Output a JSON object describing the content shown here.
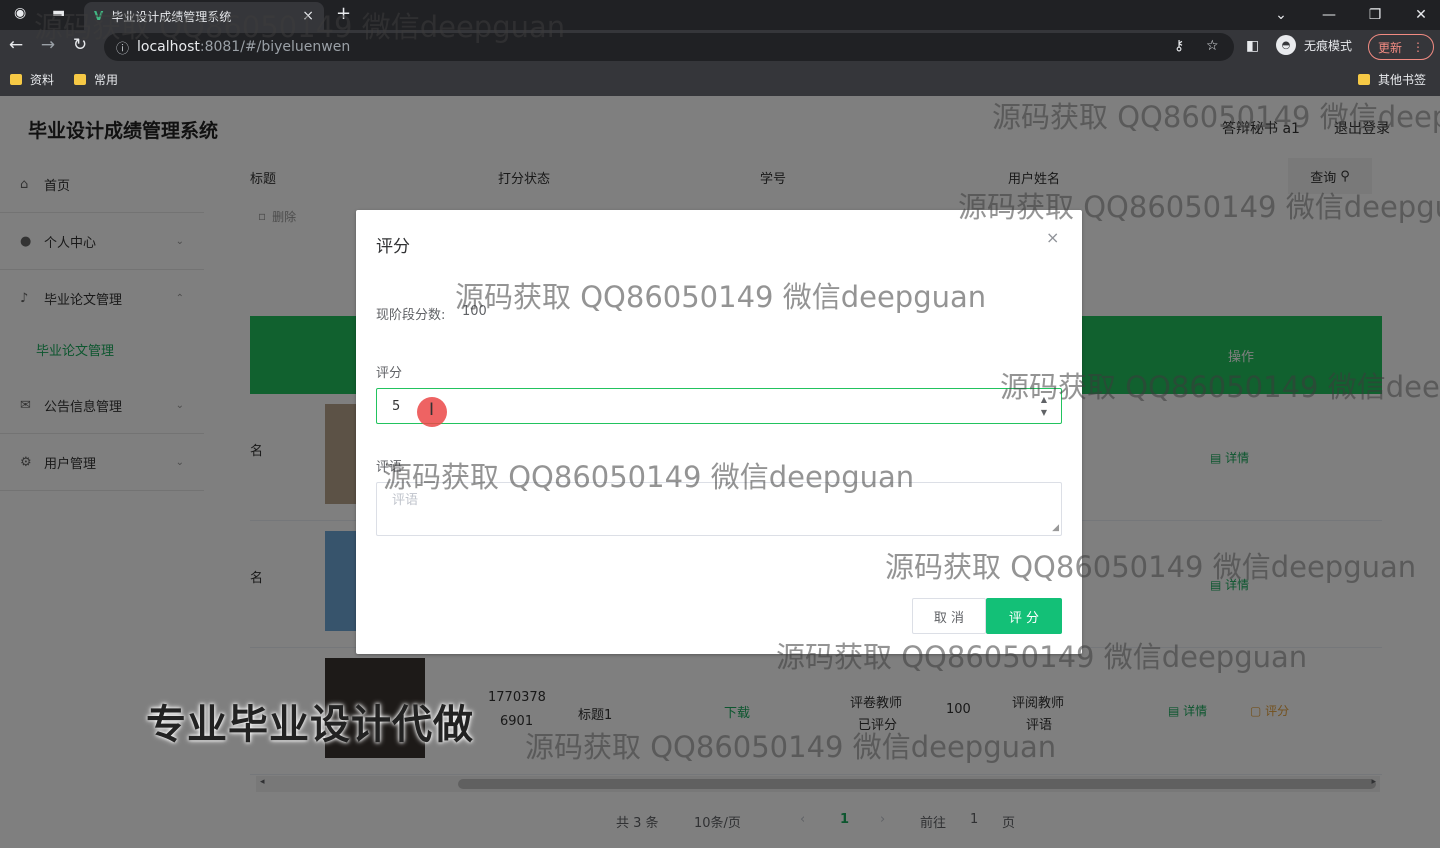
{
  "browser": {
    "tab_title": "毕业设计成绩管理系统",
    "tab_close": "×",
    "new_tab": "+",
    "url_host": "localhost",
    "url_path": ":8081/#/biyeluenwen",
    "incognito_label": "无痕模式",
    "update_label": "更新",
    "bookmarks": [
      "资料",
      "常用"
    ],
    "other_bookmarks": "其他书签"
  },
  "app": {
    "title": "毕业设计成绩管理系统",
    "user_label": "答辩秘书 a1",
    "logout": "退出登录"
  },
  "sidebar": {
    "items": [
      {
        "label": "首页",
        "icon": "home-icon"
      },
      {
        "label": "个人中心",
        "icon": "user-icon"
      },
      {
        "label": "毕业论文管理",
        "icon": "mic-icon"
      },
      {
        "label": "公告信息管理",
        "icon": "mail-icon"
      },
      {
        "label": "用户管理",
        "icon": "settings-icon"
      }
    ],
    "sub_item": "毕业论文管理"
  },
  "search": {
    "labels": [
      "标题",
      "打分状态",
      "学号",
      "用户姓名"
    ],
    "query_button": "查询",
    "delete_button": "删除"
  },
  "table": {
    "op_header": "操作",
    "row_labels": [
      "名",
      "名"
    ],
    "detail_link": "详情",
    "score_link": "评分",
    "row3": {
      "phone_line1": "1770378",
      "phone_line2": "6901",
      "title": "标题1",
      "file": "下载",
      "reviewer_line1": "评卷教师",
      "reviewer_line2": "已评分",
      "score": "100",
      "teacher_line1": "评阅教师",
      "teacher_line2": "评语"
    }
  },
  "pager": {
    "total": "共 3 条",
    "size": "10条/页",
    "current": "1",
    "goto": "前往",
    "page_input": "1",
    "page_suffix": "页"
  },
  "dialog": {
    "title": "评分",
    "close": "×",
    "stage_label": "现阶段分数:",
    "stage_value": "100",
    "score_label": "评分",
    "score_value": "5",
    "comment_label": "评语",
    "comment_placeholder": "评语",
    "cancel": "取 消",
    "confirm": "评 分"
  },
  "overlay": {
    "watermark": "源码获取 QQ86050149 微信deepguan",
    "promo": "专业毕业设计代做"
  }
}
